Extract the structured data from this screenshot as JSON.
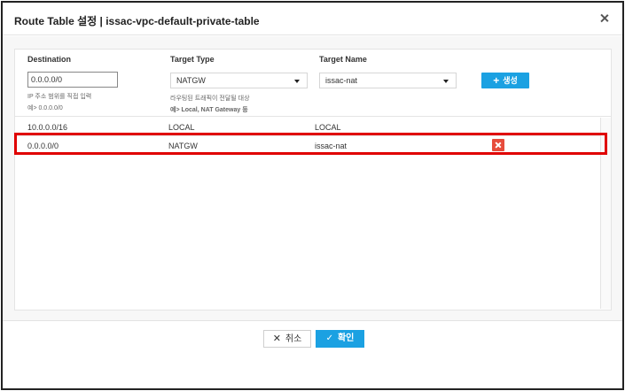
{
  "dialog": {
    "title": "Route Table 설정 | issac-vpc-default-private-table",
    "close_icon": "close-icon"
  },
  "form": {
    "columns": {
      "destination": "Destination",
      "target_type": "Target Type",
      "target_name": "Target Name"
    },
    "destination_value": "0.0.0.0/0",
    "destination_hint_1": "IP 주소 범위를 직접 입력",
    "destination_hint_2": "예> 0.0.0.0/0",
    "target_type_value": "NATGW",
    "target_type_hint_1": "라우팅된 트래픽이 전달될 대상",
    "target_type_hint_2": "예> Local, NAT Gateway 등",
    "target_name_value": "issac-nat",
    "create_label": "생성",
    "create_icon": "plus-icon"
  },
  "routes": [
    {
      "destination": "10.0.0.0/16",
      "target_type": "LOCAL",
      "target_name": "LOCAL",
      "deletable": false
    },
    {
      "destination": "0.0.0.0/0",
      "target_type": "NATGW",
      "target_name": "issac-nat",
      "deletable": true
    }
  ],
  "footer": {
    "cancel_label": "취소",
    "ok_label": "확인"
  },
  "colors": {
    "accent": "#1ba1e2",
    "delete": "#e74c3c",
    "highlight": "#e00000"
  }
}
